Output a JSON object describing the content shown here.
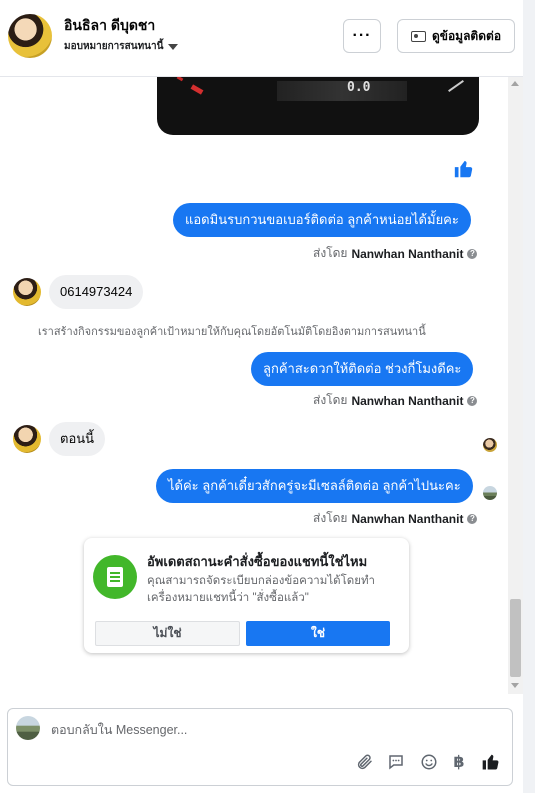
{
  "header": {
    "contact_name": "อินธิลา ดีบุดชา",
    "assign_label": "มอบหมายการสนทนานี้",
    "more_label": "···",
    "view_contact_label": "ดูข้อมูลติดต่อ"
  },
  "messages": {
    "image_readout": "0.0",
    "m1": "แอดมินรบกวนขอเบอร์ติดต่อ ลูกค้าหน่อยได้มั้ยคะ",
    "m2": "0614973424",
    "m3": "ลูกค้าสะดวกให้ติดต่อ ช่วงกี่โมงดีคะ",
    "m4": "ตอนนี้",
    "m5": "ได้ค่ะ ลูกค้าเดี๋ยวสักครู่จะมีเซลล์ติดต่อ ลูกค้าไปนะคะ"
  },
  "sent_by": {
    "prefix": "ส่งโดย",
    "name": "Nanwhan Nanthanit"
  },
  "notice": "เราสร้างกิจกรรมของลูกค้าเป้าหมายให้กับคุณโดยอัตโนมัติโดยอิงตามการสนทนานี้",
  "order_card": {
    "title": "อัพเดตสถานะคำสั่งซื้อของแชทนี้ใช่ไหม",
    "description": "คุณสามารถจัดระเบียบกล่องข้อความได้โดยทำ\nเครื่องหมายแชทนี้ว่า \"สั่งซื้อแล้ว\"",
    "no_label": "ไม่ใช่",
    "yes_label": "ใช่"
  },
  "composer": {
    "placeholder": "ตอบกลับใน Messenger..."
  },
  "colors": {
    "accent": "#1877f2",
    "incoming_bubble": "#eff0f2",
    "order_icon": "#42b72a"
  },
  "icons": [
    "more-icon",
    "contact-card-icon",
    "caret-down-icon",
    "like-icon",
    "help-icon",
    "order-doc-icon",
    "attachment-icon",
    "saved-replies-icon",
    "emoji-icon",
    "baht-icon",
    "like-send-icon"
  ]
}
